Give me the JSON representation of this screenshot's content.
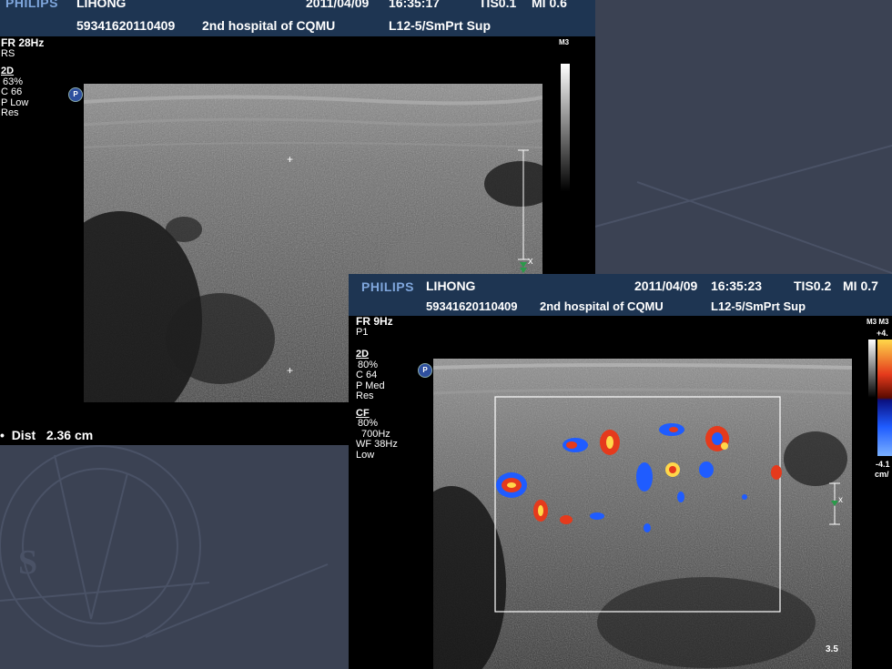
{
  "background": {
    "color": "#3b4253"
  },
  "scan1": {
    "logo": "PHILIPS",
    "patient": "LIHONG",
    "date": "2011/04/09",
    "time": "16:35:17",
    "tis": "TIS0.1",
    "mi": "MI 0.6",
    "patient_id": "59341620110409",
    "hospital": "2nd hospital of CQMU",
    "probe": "L12-5/SmPrt Sup",
    "frame_rate": "FR 28Hz",
    "mode_line": "RS",
    "params_title": "2D",
    "params": [
      "63%",
      "C 66",
      "P Low",
      "Res"
    ],
    "map_label": "M3",
    "dist_label": "Dist",
    "dist_value": "2.36 cm",
    "badge": "P"
  },
  "scan2": {
    "logo": "PHILIPS",
    "patient": "LIHONG",
    "date": "2011/04/09",
    "time": "16:35:23",
    "tis": "TIS0.2",
    "mi": "MI 0.7",
    "patient_id": "59341620110409",
    "hospital": "2nd hospital of CQMU",
    "probe": "L12-5/SmPrt Sup",
    "frame_rate": "FR 9Hz",
    "mode_line": "P1",
    "params_title": "2D",
    "params": [
      "80%",
      "C 64",
      "P Med",
      "Res"
    ],
    "cf_title": "CF",
    "cf_params": [
      "80%",
      "700Hz",
      "WF  38Hz",
      "Low"
    ],
    "map_label": "M3 M3",
    "scale_top": "+4.",
    "scale_bottom": "-4.1",
    "scale_unit": "cm/",
    "depth": "3.5",
    "badge": "P"
  },
  "colors": {
    "header": "#1e3552",
    "logo": "#7fa6dc",
    "doppler_red": "#e53a1c",
    "doppler_blue": "#1f5cff"
  }
}
